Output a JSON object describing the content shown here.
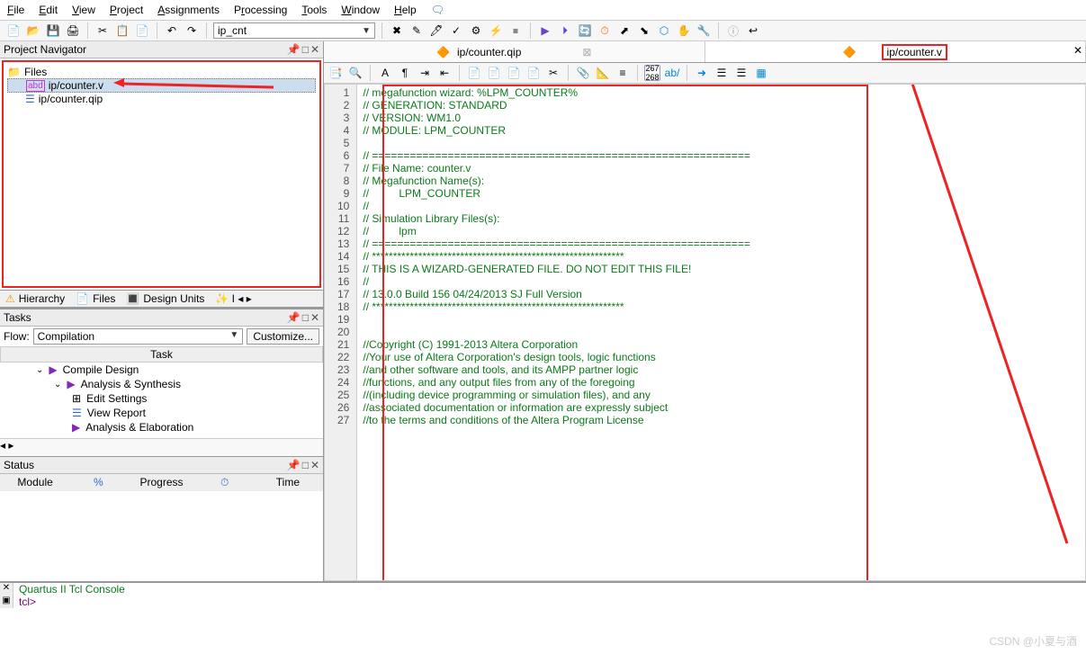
{
  "menu": [
    "File",
    "Edit",
    "View",
    "Project",
    "Assignments",
    "Processing",
    "Tools",
    "Window",
    "Help"
  ],
  "project_combo": "ip_cnt",
  "panels": {
    "navigator_title": "Project Navigator",
    "files_root": "Files",
    "file1": "ip/counter.v",
    "file2": "ip/counter.qip",
    "hierarchy_tab": "Hierarchy",
    "files_tab": "Files",
    "design_units_tab": "Design Units",
    "tasks_title": "Tasks",
    "flow_label": "Flow:",
    "flow_value": "Compilation",
    "customize": "Customize...",
    "task_header": "Task",
    "compile_design": "Compile Design",
    "analysis": "Analysis & Synthesis",
    "edit_settings": "Edit Settings",
    "view_report": "View Report",
    "elaboration": "Analysis & Elaboration",
    "status_title": "Status",
    "status_cols": [
      "Module",
      "%",
      "Progress",
      "⏱",
      "Time"
    ]
  },
  "tabs": {
    "t1": "ip/counter.qip",
    "t2": "ip/counter.v"
  },
  "gutter": [
    "1",
    "2",
    "3",
    "4",
    "5",
    "6",
    "7",
    "8",
    "9",
    "10",
    "11",
    "12",
    "13",
    "14",
    "15",
    "16",
    "17",
    "18",
    "19",
    "20",
    "21",
    "22",
    "23",
    "24",
    "25",
    "26",
    "27"
  ],
  "code_lines": [
    "// megafunction wizard: %LPM_COUNTER%",
    "// GENERATION: STANDARD",
    "// VERSION: WM1.0",
    "// MODULE: LPM_COUNTER",
    "",
    "// ============================================================",
    "// File Name: counter.v",
    "// Megafunction Name(s):",
    "//          LPM_COUNTER",
    "//",
    "// Simulation Library Files(s):",
    "//          lpm",
    "// ============================================================",
    "// ************************************************************",
    "// THIS IS A WIZARD-GENERATED FILE. DO NOT EDIT THIS FILE!",
    "//",
    "// 13.0.0 Build 156 04/24/2013 SJ Full Version",
    "// ************************************************************",
    "",
    "",
    "//Copyright (C) 1991-2013 Altera Corporation",
    "//Your use of Altera Corporation's design tools, logic functions ",
    "//and other software and tools, and its AMPP partner logic ",
    "//functions, and any output files from any of the foregoing ",
    "//(including device programming or simulation files), and any ",
    "//associated documentation or information are expressly subject ",
    "//to the terms and conditions of the Altera Program License "
  ],
  "console": {
    "title": "Quartus II Tcl Console",
    "prompt": "tcl>"
  },
  "watermark": "CSDN @小夏与酒"
}
